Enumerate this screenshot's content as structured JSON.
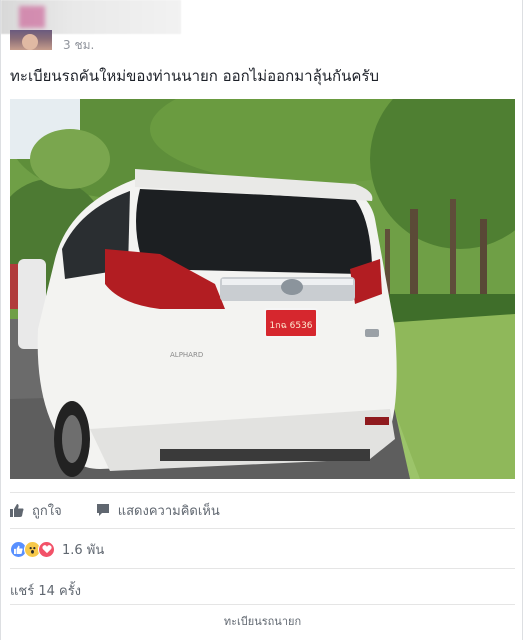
{
  "post": {
    "timestamp": "3 ชม.",
    "text": "ทะเบียนรถคันใหม่ของท่านนายก ออกไม่ออกมาลุ้นกันครับ",
    "photo": {
      "car_badge": "ALPHARD",
      "plate_text": "1กฉ 6536"
    },
    "actions": {
      "like_label": "ถูกใจ",
      "comment_label": "แสดงความคิดเห็น"
    },
    "reactions": {
      "types": [
        "like",
        "wow",
        "love"
      ],
      "count": "1.6 พัน"
    },
    "shares": "แชร์ 14 ครั้ง",
    "caption": "ทะเบียนรถนายก"
  },
  "colors": {
    "like": "#5890ff",
    "wow": "#f7c94a",
    "love": "#f25268",
    "plate": "#d6272e"
  }
}
